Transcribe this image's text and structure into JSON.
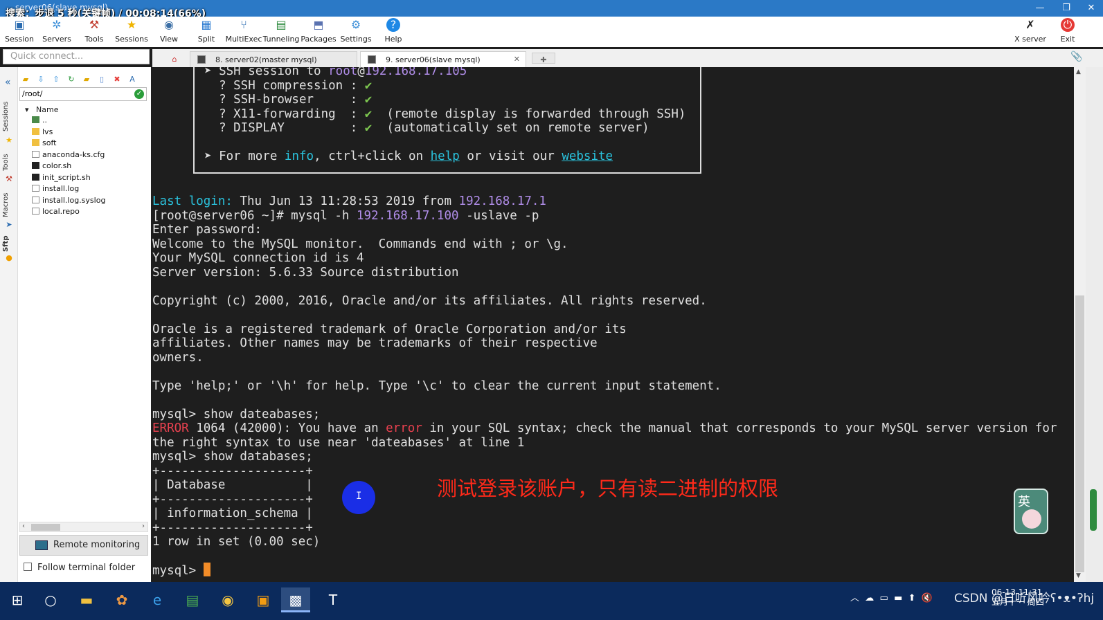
{
  "window": {
    "title": "server06(slave mysql)",
    "overlay": "搜索：步退 5 秒(关键帧) / 00:08:14(66%)",
    "min": "—",
    "max": "❐",
    "close": "✕"
  },
  "toolbar": {
    "session": "Session",
    "servers": "Servers",
    "tools": "Tools",
    "sessions": "Sessions",
    "view": "View",
    "split": "Split",
    "multiexec": "MultiExec",
    "tunneling": "Tunneling",
    "packages": "Packages",
    "settings": "Settings",
    "help": "Help",
    "xserver": "X server",
    "exit": "Exit"
  },
  "quick_connect": {
    "placeholder": "Quick connect..."
  },
  "tabs": [
    {
      "label": "8. server02(master mysql)"
    },
    {
      "label": "9. server06(slave mysql)"
    }
  ],
  "sidebar": {
    "vtabs": [
      "Sessions",
      "Tools",
      "Macros",
      "Sftp"
    ],
    "path": "/root/",
    "header": "Name",
    "files": [
      "..",
      "lvs",
      "soft",
      "anaconda-ks.cfg",
      "color.sh",
      "init_script.sh",
      "install.log",
      "install.log.syslog",
      "local.repo"
    ],
    "remote_monitoring": "Remote monitoring",
    "follow_terminal": "Follow terminal folder"
  },
  "terminal": {
    "box_lines": [
      {
        "pre": "➤ SSH session to ",
        "user": "root",
        "at": "@",
        "ip": "192.168.17.105"
      },
      {
        "pre": "  ? SSH compression : ",
        "check": "✔",
        "post": ""
      },
      {
        "pre": "  ? SSH-browser     : ",
        "check": "✔",
        "post": ""
      },
      {
        "pre": "  ? X11-forwarding  : ",
        "check": "✔",
        "post": "  (remote display is forwarded through SSH)"
      },
      {
        "pre": "  ? DISPLAY         : ",
        "check": "✔",
        "post": "  (automatically set on remote server)"
      }
    ],
    "more": {
      "pre": "➤ For more ",
      "info": "info",
      "mid": ", ctrl+click on ",
      "help": "help",
      "mid2": " or visit our ",
      "website": "website"
    },
    "last_login": {
      "label": "Last login:",
      "text": " Thu Jun 13 11:28:53 2019 from ",
      "ip": "192.168.17.1"
    },
    "cmd": {
      "prompt": "[root@server06 ~]# mysql -h ",
      "ip": "192.168.17.100",
      "rest": " -uslave -p"
    },
    "lines1": [
      "Enter password:",
      "Welcome to the MySQL monitor.  Commands end with ; or \\g.",
      "Your MySQL connection id is 4",
      "Server version: 5.6.33 Source distribution",
      "",
      "Copyright (c) 2000, 2016, Oracle and/or its affiliates. All rights reserved.",
      "",
      "Oracle is a registered trademark of Oracle Corporation and/or its",
      "affiliates. Other names may be trademarks of their respective",
      "owners.",
      "",
      "Type 'help;' or '\\h' for help. Type '\\c' to clear the current input statement.",
      "",
      "mysql> show dateabases;"
    ],
    "error": {
      "word": "ERROR",
      "a": " 1064 (42000): You have an ",
      "err": "error",
      "b": " in your SQL syntax; check the manual that corresponds to your MySQL server version for"
    },
    "lines2": [
      "the right syntax to use near 'dateabases' at line 1",
      "mysql> show databases;",
      "+--------------------+",
      "| Database           |",
      "+--------------------+",
      "| information_schema |",
      "+--------------------+",
      "1 row in set (0.00 sec)",
      ""
    ],
    "prompt_final": "mysql> "
  },
  "annotation": "测试登录该账户，只有读二进制的权限",
  "ime": "英",
  "tray": {
    "watermark": "CSDN @日听风吟ʕ•ᴥ•ʔhj",
    "date": "06-13 11:31",
    "weekday": "五月十一 周四"
  }
}
